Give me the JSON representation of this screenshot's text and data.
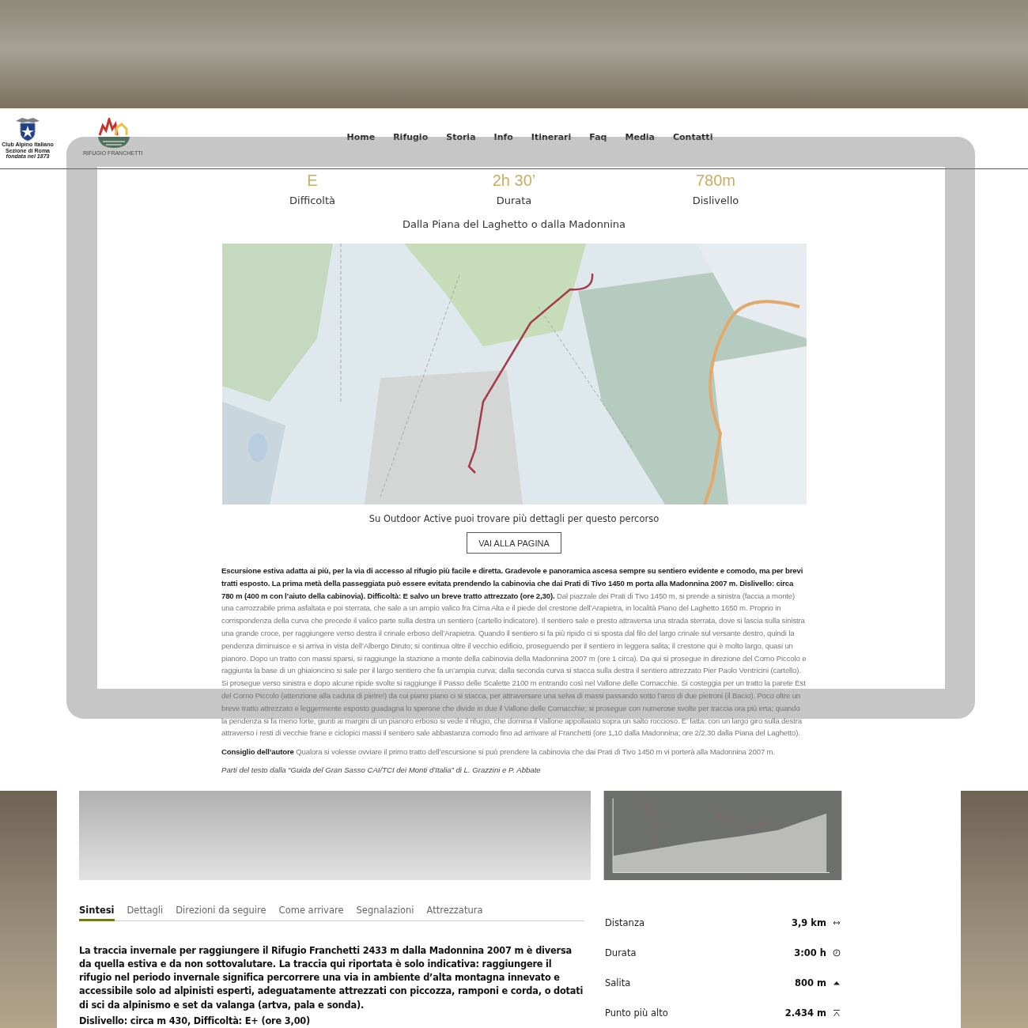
{
  "header": {
    "club_lines": [
      "Club Alpino Italiano",
      "Sezione di Roma",
      "fondata nel 1873"
    ],
    "logo_text": "RIFUGIO FRANCHETTI",
    "nav": [
      "Home",
      "Rifugio",
      "Storia",
      "Info",
      "Itinerari",
      "Faq",
      "Media",
      "Contatti"
    ]
  },
  "stats": [
    {
      "value": "E",
      "label": "Difficoltà"
    },
    {
      "value": "2h 30’",
      "label": "Durata"
    },
    {
      "value": "780m",
      "label": "Dislivello"
    }
  ],
  "route_title": "Dalla Piana del Laghetto o dalla Madonnina",
  "map_caption": "Su Outdoor Active puoi trovare più dettagli per questo percorso",
  "button": "VAI ALLA PAGINA",
  "description": "**Escursione estiva adatta ai più, per la via di accesso al rifugio più facile e diretta. Gradevole e panoramica ascesa sempre su sentiero evidente e comodo, ma per brevi tratti esposto. La prima metà della passeggiata può essere evitata prendendo la cabinovia che dai Prati di Tivo 1450 m porta alla Madonnina 2007 m. Dislivello: circa 780 m (400 m con l’aiuto della cabinovia). Difficoltà: E salvo un breve tratto attrezzato (ore 2,30).** Dal piazzale dei Prati di Tivo 1450 m, si prende a sinistra (faccia a monte) una carrozzabile prima asfaltata e poi sterrata, che sale a un ampio valico fra Cima Alta e il piede del crestone dell’Arapietra, in località Piano del Laghetto 1650 m. Proprio in corrispondenza della curva che precede il valico parte sulla destra un sentiero (cartello indicatore). Il sentiero sale e presto attraversa una strada sterrata, dove si lascia sulla sinistra una grande croce, per raggiungere verso destra il crinale erboso dell’Arapietra. Quando il sentiero si fa più ripido ci si sposta dal filo del largo crinale sul versante destro, quindi la pendenza diminuisce e si arriva in vista dell’Albergo Diruto; si continua oltre il vecchio edificio, proseguendo per il sentiero in leggera salita; il crestone qui è molto largo, quasi un pianoro. Dopo un tratto con massi sparsi, si raggiunge la stazione a monte della cabinovia della Madonnina 2007 m (ore 1 circa). Da qui si prosegue in direzione del Corno Piccolo e raggiunta la base di un ghiaioncino si sale per il largo sentiero che fa un’ampia curva; dalla seconda curva si stacca sulla destra il sentiero attrezzato Pier Paolo Ventricini (cartello). Si prosegue verso sinistra e dopo alcune ripide svolte si raggiunge il Passo delle Scalette 2100 m entrando così nel Vallone delle Cornacchie. Si costeggia per un tratto la parete Est del Corno Piccolo (attenzione alla caduta di pietre!) da cui piano piano ci si stacca, per attraversare una selva di massi passando sotto l’arco di due pietroni (il Bacio). Poco oltre un breve tratto attrezzato e leggermente esposto guadagna lo sperone che divide in due il Vallone delle Cornacchie; si prosegue con numerose svolte per traccia ora più erta; quando la pendenza si fa meno forte, giunti ai margini di un pianoro erboso si vede il rifugio, che domina il Vallone appollaiato sopra un salto roccioso. E’ fatta: con un largo giro sulla destra attraverso i resti di vecchie frane e ciclopici massi il sentiero sale abbastanza comodo fino ad arrivare al Franchetti (ore 1,10 dalla Madonnina; ore 2/2,30 dalla Piana del Laghetto).",
  "tip": "**Consiglio dell’autore** Qualora si volesse ovviare il primo tratto dell’escursione si può prendere la cabinovia che dai Prati di Tivo 1450 m vi porterà alla Madonnina 2007 m.",
  "credit": "Parti del testo dalla “Guida del Gran Sasso CAI/TCI dei Monti d’Italia” di L. Grazzini e P. Abbate",
  "outdoor": {
    "tabs": [
      {
        "label": "Sintesi",
        "selected": true
      },
      {
        "label": "Dettagli",
        "selected": false
      },
      {
        "label": "Direzioni da seguire",
        "selected": false
      },
      {
        "label": "Come arrivare",
        "selected": false
      },
      {
        "label": "Segnalazioni",
        "selected": false
      },
      {
        "label": "Attrezzatura",
        "selected": false
      }
    ],
    "summary": "La traccia invernale per raggiungere il Rifugio Franchetti 2433 m dalla Madonnina 2007 m è diversa da quella estiva e da non sottovalutare. La traccia qui riportata è solo indicativa: raggiungere il rifugio nel periodo invernale significa percorrere una via in ambiente d’alta montagna innevato e accessibile solo ad alpinisti esperti, adeguatamente attrezzati con piccozza, ramponi e corda, o dotati di sci da alpinismo e set da valanga (artva, pala e sonda).",
    "summary_next": "Dislivello: circa m 430, Difficoltà: E+ (ore 3,00)",
    "facts": [
      {
        "kind": "distance",
        "label": "Distanza",
        "value": "3,9 km"
      },
      {
        "kind": "duration",
        "label": "Durata",
        "value": "3:00 h"
      },
      {
        "kind": "ascent",
        "label": "Salita",
        "value": "800 m"
      },
      {
        "kind": "highest",
        "label": "Punto più alto",
        "value": "2.434 m"
      }
    ]
  }
}
